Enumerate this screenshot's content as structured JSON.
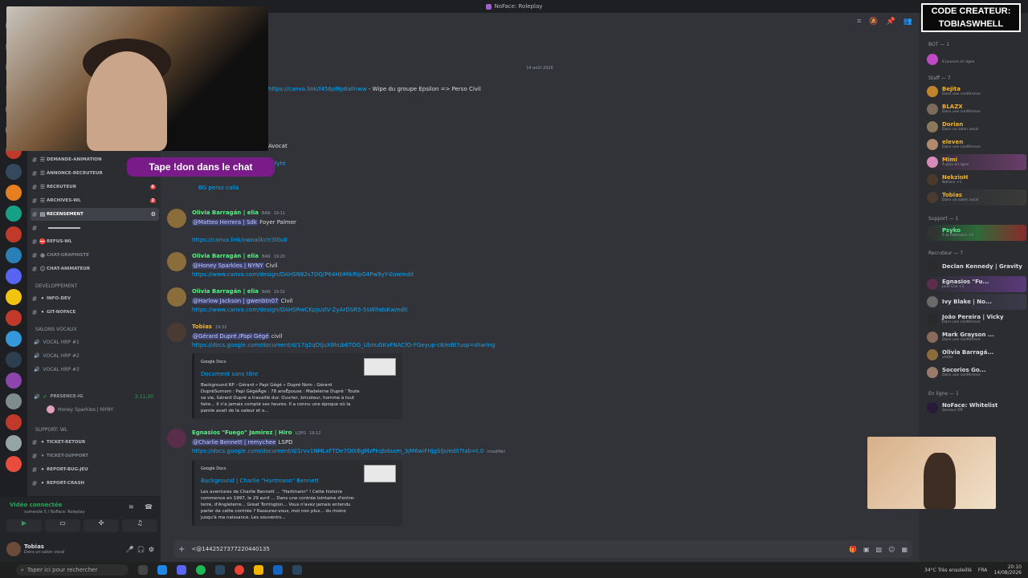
{
  "window": {
    "title": "NoFace: Roleplay"
  },
  "overlay": {
    "banner": "Tape !don dans le chat",
    "code_line1": "CODE CREATEUR:",
    "code_line2": "TOBIASWHELL"
  },
  "channels": [
    {
      "name": "DEMANDE-ANIMATION",
      "badge": ""
    },
    {
      "name": "ANNONCE-RECRUTEUR",
      "badge": ""
    },
    {
      "name": "RECRUTEUR",
      "badge": "6"
    },
    {
      "name": "ARCHIVES-WL",
      "badge": "2"
    },
    {
      "name": "RECENSEMENT",
      "badge": ""
    },
    {
      "name": "REFUS-WL",
      "badge": ""
    },
    {
      "name": "CHAT-GRAPHISTE",
      "badge": ""
    },
    {
      "name": "CHAT-ANIMATEUR",
      "badge": ""
    }
  ],
  "cat_dev": "DEVELOPPEMENT",
  "dev_channels": [
    "INFO-DEV",
    "GIT-NOFACE"
  ],
  "cat_voice": "SALONS VOCAUX",
  "voice_channels": [
    "VOCAL HRP #1",
    "VOCAL HRP #2",
    "VOCAL HRP #3"
  ],
  "presence": {
    "name": "PRESENCE-IG",
    "time": "2:11:20",
    "user": "Honey Sparkles | NYNY"
  },
  "cat_support": "SUPPORT: WL",
  "support_channels": [
    "TICKET-RETOUR",
    "TICKET-SUPPORT",
    "REPORT-BUG-JEU",
    "REPORT-CRASH"
  ],
  "voice_connected": {
    "label": "Vidéo connectée",
    "sub": "sumerole 5 / NoFace: Roleplay"
  },
  "user": {
    "name": "Tobias",
    "status": "Dans un salon vocal"
  },
  "chat": {
    "date": "14 août 2026",
    "top_link": "https://canva.link/f456pl8p6allnww",
    "top_text": " - Wipe du groupe Epsilon => Perso Civil",
    "avocat": "Avocat",
    "fyht": "fyht",
    "bg_calla": "BG perso calla",
    "messages": [
      {
        "author": "Olivia Barragán | elia",
        "tag": "BAN",
        "time": "19:11",
        "mention": "@Matteo Herrera | Sdk",
        "text": " Foyer Palmer",
        "link": "https://canva.link/owoailkctr3l0u0"
      },
      {
        "author": "Olivia Barragán | elia",
        "tag": "BAN",
        "time": "19:20",
        "mention": "@Honey Sparkles | NYNY",
        "text": " Civil",
        "link": "https://www.canva.com/design/DAHSN82s7DQ/P64HbMlkRlpG4Pw9yY-Eow/edit"
      },
      {
        "author": "Olivia Barragán | elia",
        "tag": "BAN",
        "time": "19:32",
        "mention": "@Harlow Jackson | gwenbtn07",
        "text": " Civil",
        "link": "https://www.canva.com/design/DAHSRwCKpjs/zlV-ZyArDSR5-5sWlhdsKw/edit"
      }
    ],
    "tobias_msg": {
      "author": "Tobias",
      "time": "19:32",
      "mention": "@Gérard Dupré /Papi Gégé",
      "text": " civil",
      "link": "https://docs.google.com/document/d/17q2qDtjuX8hub6TOG_UbnuGKvFNACfO-FGeyup-c8/edit?usp=sharing",
      "embed_provider": "Google Docs",
      "embed_title": "Document sans titre",
      "embed_desc": "Background RP - Gérard « Papi Gégé » Dupré Nom : Gérard DupréSurnom : Papi GégéÂge : 78 ansÉpouse : Madeleine Dupré ' Toute sa vie, Gérard Dupré a travaillé dur. Ouvrier, bricoleur, homme à tout faire... Il n'a jamais compté ses heures. Il a connu une époque où la parole avait de la valeur et o..."
    },
    "egnasios_msg": {
      "author": "Egnasios \"Fuego\" Jamirez | Hiro",
      "tag": "LQPG",
      "time": "19:12",
      "mention": "@Charlie Bennett | remychee",
      "text": " LSPD",
      "link": "https://docs.google.com/document/d/1rvv1NMLxFTDe7QIXBgMzPkqbdaxm_3jM6wiFHjgSlJs/edit?tab=t.0",
      "edited": "(modifié)",
      "embed_provider": "Google Docs",
      "embed_title": "Background | Charlie \"Hartmann\" Bennett",
      "embed_desc": "Les aventures de Charlie Bennett ... \"Hartmann\" ! Cette histoire commence en 1997, le 29 avril ... Dans une contrée lointaine d'entre-terre, d'Angleterre... Great Torrington... Vous n'avez jamais entendu parler de cette contrée ? Rassurez-vous, moi non plus... du moins jusqu'à ma naissance. Les souvenirs..."
    },
    "input_value": "<@1442527377220440135"
  },
  "members": {
    "bot_cat": "BOT — 1",
    "bot_status": "6 joueurs en ligne",
    "staff_cat": "Staff — 7",
    "staff": [
      {
        "name": "Bejita",
        "sub": "Dans une conférence"
      },
      {
        "name": "BLAZX",
        "sub": "Dans une conférence"
      },
      {
        "name": "Dorian",
        "sub": "Dans un salon vocal"
      },
      {
        "name": "eleven",
        "sub": "Dans une conférence"
      },
      {
        "name": "Mimi",
        "sub": "À plus en ligne"
      },
      {
        "name": "NekzioH",
        "sub": "NoFace +1"
      },
      {
        "name": "Tobias",
        "sub": "Dans un salon vocal"
      }
    ],
    "support_cat": "Support — 1",
    "support": [
      {
        "name": "Psyko",
        "sub": "À la Rallmann +1"
      }
    ],
    "recruteur_cat": "Recruteur — 7",
    "recruteurs": [
      {
        "name": "Declan Kennedy | Gravity",
        "sub": ""
      },
      {
        "name": "Egnasios \"Fu...",
        "sub": "Joue Civi +1"
      },
      {
        "name": "Ivy Blake | No...",
        "sub": ""
      },
      {
        "name": "João Pereira | Vicky",
        "sub": "Dans une conférence"
      },
      {
        "name": "Mark Grayson ...",
        "sub": "Dans une conférence"
      },
      {
        "name": "Olivia Barragá...",
        "sub": "vntiks"
      },
      {
        "name": "Socorios Go...",
        "sub": "Dans une conférence"
      }
    ],
    "online_cat": "En ligne — 1",
    "online": [
      {
        "name": "NoFace: Whitelist",
        "sub": "Serveur Off"
      }
    ]
  },
  "taskbar": {
    "search": "Taper ici pour rechercher",
    "weather": "34°C  Très ensoleillé",
    "lang": "FRA",
    "clock": "20:10",
    "date": "14/08/2026"
  }
}
